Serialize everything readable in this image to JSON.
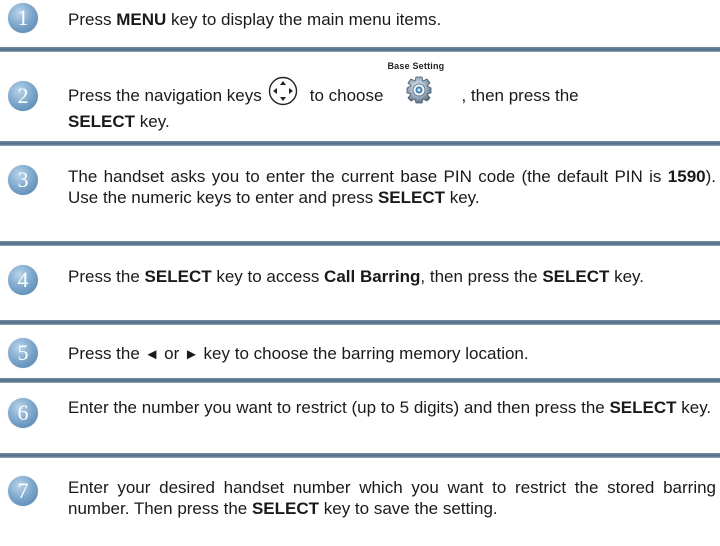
{
  "steps": [
    {
      "num": "1",
      "parts": [
        "Press ",
        "MENU",
        " key to display the main menu items."
      ]
    },
    {
      "num": "2",
      "parts": [
        "Press the navigation keys",
        "to choose",
        ", then press the",
        "SELECT",
        " key."
      ],
      "base_setting_label": "Base Setting"
    },
    {
      "num": "3",
      "parts": [
        "The handset asks you to enter the current base PIN code (the default PIN is ",
        "1590",
        "). Use the numeric keys to enter and press ",
        "SELECT",
        " key."
      ]
    },
    {
      "num": "4",
      "parts": [
        "Press the ",
        "SELECT",
        " key to access ",
        "Call Barring",
        ", then press the ",
        "SELECT",
        " key."
      ]
    },
    {
      "num": "5",
      "parts": [
        "Press the ",
        "◄",
        " or ",
        "►",
        " key to choose the barring memory location."
      ]
    },
    {
      "num": "6",
      "parts": [
        "Enter the number you want to restrict (up to 5 digits) and then press the ",
        "SELECT",
        " key."
      ]
    },
    {
      "num": "7",
      "parts": [
        "Enter your desired handset number which you want to restrict the stored barring number. Then press the ",
        "SELECT",
        " key to save the setting."
      ]
    }
  ],
  "icons": {
    "navigation": "navigation-keys-icon",
    "base_setting": "base-setting-gear-icon"
  },
  "colors": {
    "step_number_bg": "#6f9bc4",
    "divider": "#5a768f",
    "text": "#1a1a1a"
  }
}
